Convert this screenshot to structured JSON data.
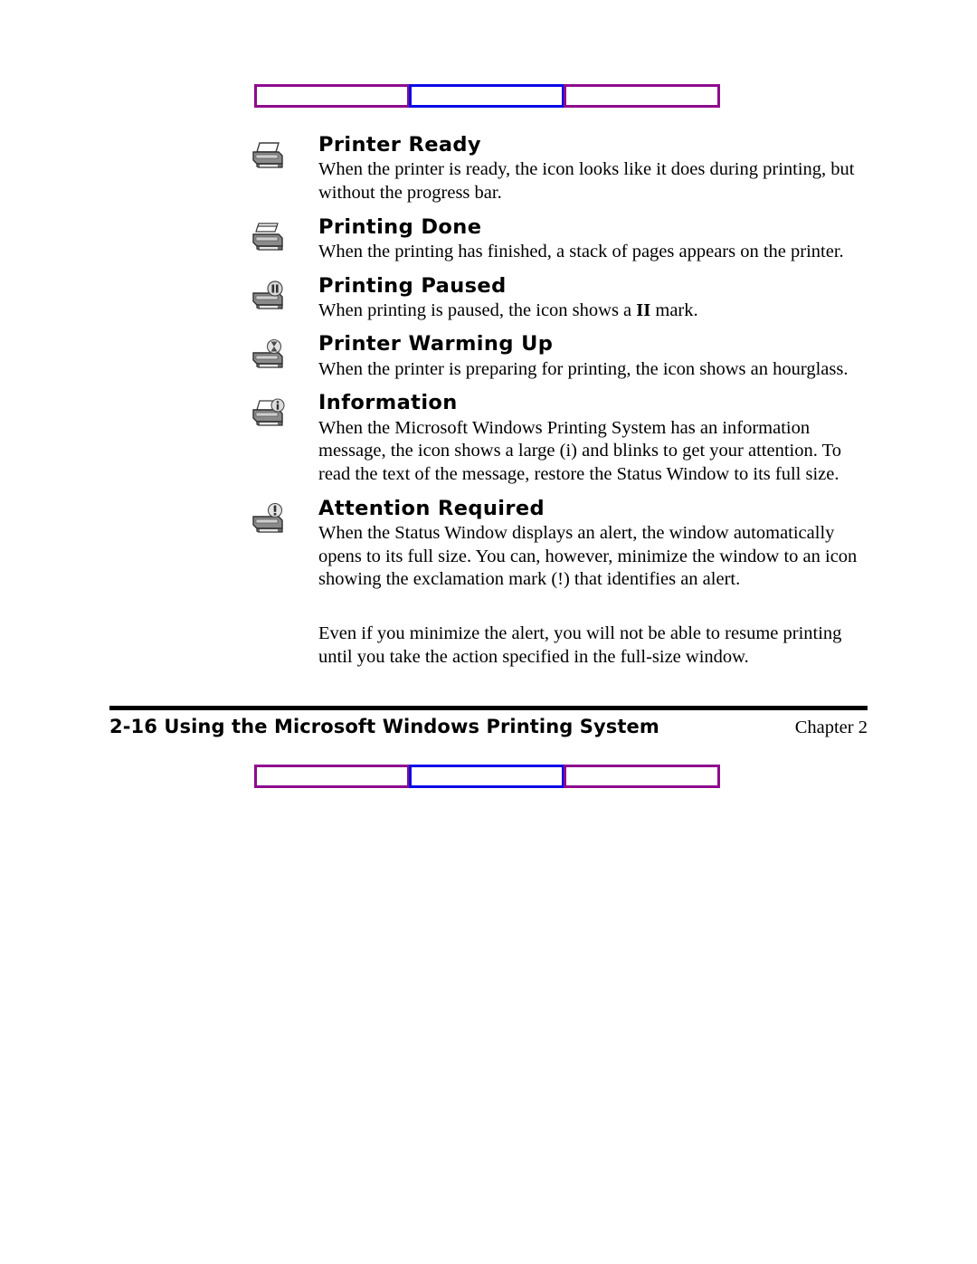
{
  "decor": {
    "purple": "#8e0b8e",
    "blue": "#0a0ae6",
    "segments": [
      "left-purple-box",
      "middle-blue-box",
      "right-purple-box"
    ]
  },
  "sections": [
    {
      "icon": "printer-ready-icon",
      "title": "Printer Ready",
      "body_before": "When the printer is ready, the icon looks like it does during printing, but without the progress bar.",
      "body_bold": "",
      "body_after": ""
    },
    {
      "icon": "printer-done-icon",
      "title": "Printing Done",
      "body_before": "When the printing has finished, a stack of pages appears on the printer.",
      "body_bold": "",
      "body_after": ""
    },
    {
      "icon": "printer-paused-icon",
      "title": "Printing Paused",
      "body_before": "When printing is paused, the icon shows a ",
      "body_bold": "II",
      "body_after": " mark."
    },
    {
      "icon": "printer-warming-up-icon",
      "title": "Printer Warming Up",
      "body_before": "When the printer is preparing for printing, the icon shows an hourglass.",
      "body_bold": "",
      "body_after": ""
    },
    {
      "icon": "printer-information-icon",
      "title": "Information",
      "body_before": "When the Microsoft Windows Printing System has an information message, the icon shows a large (i) and blinks to get your attention. To read the text of the message, restore the Status Window to its full size.",
      "body_bold": "",
      "body_after": ""
    },
    {
      "icon": "printer-attention-icon",
      "title": "Attention Required",
      "body_before": "When the Status Window displays an alert, the window automatically opens to its full size. You can, however, minimize the window to an icon showing the exclamation mark (!) that identifies an alert.",
      "body_bold": "",
      "body_after": ""
    }
  ],
  "closing_paragraph": "Even if you minimize the alert, you will not be able to resume printing until you take the action specified in the full-size window.",
  "footer": {
    "folio": "2-16",
    "title": " Using the Microsoft Windows Printing System",
    "chapter": "Chapter 2"
  }
}
